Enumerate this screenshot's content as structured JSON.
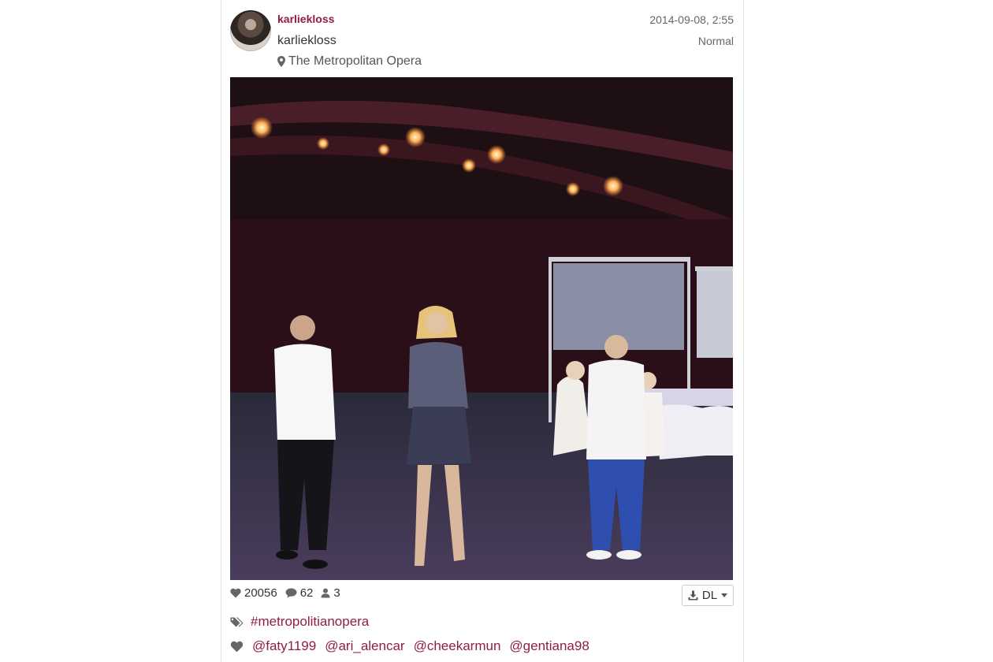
{
  "post": {
    "username": "karliekloss",
    "full_name": "karliekloss",
    "location": "The Metropolitan Opera",
    "timestamp": "2014-09-08, 2:55",
    "filter": "Normal",
    "likes": "20056",
    "comments": "62",
    "users_tagged": "3",
    "download_label": "DL"
  },
  "tags": [
    "#metropolitianopera"
  ],
  "likers": [
    "@faty1199",
    "@ari_alencar",
    "@cheekarmun",
    "@gentiana98"
  ],
  "colors": {
    "accent": "#8f1f3f",
    "icon_gray": "#666666",
    "border": "#e3e3e3"
  },
  "icons": {
    "location": "map-pin-icon",
    "likes": "heart-icon",
    "comments": "comment-icon",
    "users": "user-icon",
    "download": "download-icon",
    "caret": "caret-down-icon",
    "tags": "tags-icon",
    "likers": "heart-icon"
  }
}
